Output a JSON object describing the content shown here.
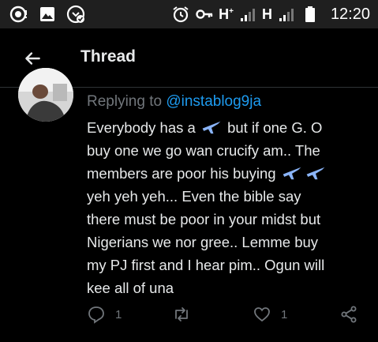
{
  "status_bar": {
    "icons_left": [
      "record-icon",
      "image-icon",
      "download-icon"
    ],
    "network_1": "H",
    "network_1_sup": "+",
    "network_2": "H",
    "time": "12:20"
  },
  "header": {
    "title": "Thread",
    "back_icon": "arrow-left-icon"
  },
  "tweet": {
    "replying_prefix": "Replying to",
    "replying_handle": "@instablog9ja",
    "lines": {
      "l1a": "Everybody has a",
      "l1b": "but if one G. O",
      "l2": "buy one we go wan crucify am.. The",
      "l3": "members are poor his buying",
      "l4": "yeh yeh yeh... Even the bible say",
      "l5": "there must be poor in your midst but",
      "l6": "Nigerians we nor gree.. Lemme buy",
      "l7": "my PJ first and I hear pim.. Ogun will",
      "l8": "kee all of una"
    },
    "emoji": "airplane"
  },
  "actions": {
    "reply_count": "1",
    "retweet_count": "",
    "like_count": "1"
  },
  "colors": {
    "background": "#000000",
    "text": "#e7e9ea",
    "muted": "#71767b",
    "accent": "#1d9bf0",
    "plane": "#8ab4f8"
  }
}
